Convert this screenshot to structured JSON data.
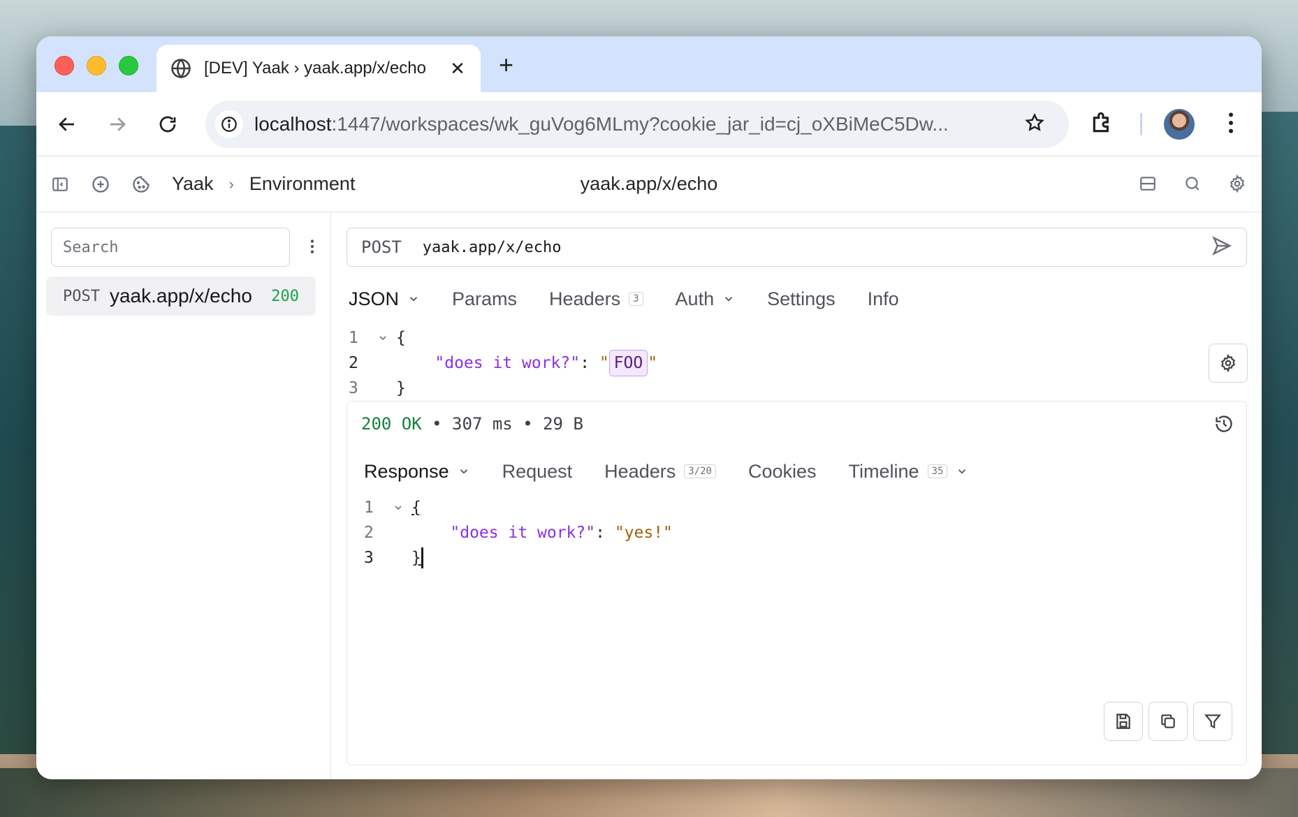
{
  "browser": {
    "tab_title": "[DEV] Yaak › yaak.app/x/echo",
    "address": {
      "host": "localhost",
      "path": ":1447/workspaces/wk_guVog6MLmy?cookie_jar_id=cj_oXBiMeC5Dw..."
    }
  },
  "app_header": {
    "breadcrumb_workspace": "Yaak",
    "breadcrumb_environment": "Environment",
    "title": "yaak.app/x/echo"
  },
  "sidebar": {
    "search_placeholder": "Search",
    "items": [
      {
        "method": "POST",
        "url": "yaak.app/x/echo",
        "status": "200"
      }
    ]
  },
  "request": {
    "method": "POST",
    "url": "yaak.app/x/echo",
    "tabs": {
      "body": "JSON",
      "params": "Params",
      "headers": "Headers",
      "headers_count": "3",
      "auth": "Auth",
      "settings": "Settings",
      "info": "Info"
    },
    "body_lines": {
      "n1": "1",
      "n2": "2",
      "n3": "3",
      "open": "{",
      "key": "\"does it work?\"",
      "colon": ": ",
      "q_open": "\"",
      "value": "FOO",
      "q_close": "\"",
      "close": "}"
    }
  },
  "response": {
    "status_code": "200 OK",
    "meta": " • 307 ms • 29 B",
    "tabs": {
      "response": "Response",
      "request": "Request",
      "headers": "Headers",
      "headers_count": "3/20",
      "cookies": "Cookies",
      "timeline": "Timeline",
      "timeline_count": "35"
    },
    "body_lines": {
      "n1": "1",
      "n2": "2",
      "n3": "3",
      "open": "{",
      "key": "\"does it work?\"",
      "colon": ": ",
      "value": "\"yes!\"",
      "close": "}"
    }
  },
  "colors": {
    "accent_key": "#8b2fe6",
    "string": "#a16207",
    "status_ok": "#15803d"
  }
}
